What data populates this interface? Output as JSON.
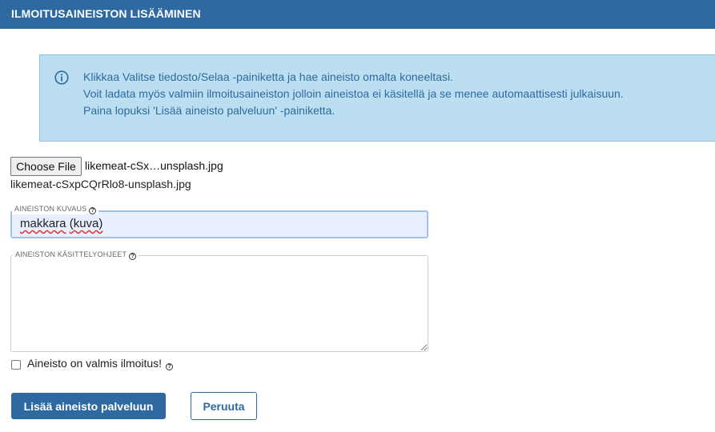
{
  "header": {
    "title": "ILMOITUSAINEISTON LISÄÄMINEN"
  },
  "info": {
    "icon": "info-icon",
    "lines": [
      "Klikkaa Valitse tiedosto/Selaa -painiketta ja hae aineisto omalta koneeltasi.",
      "Voit ladata myös valmiin ilmoitusaineiston jolloin aineistoa ei käsitellä ja se menee automaattisesti julkaisuun.",
      "Paina lopuksi 'Lisää aineisto palveluun' -painiketta."
    ]
  },
  "file": {
    "button_label": "Choose File",
    "chosen_display": "likemeat-cSx…unsplash.jpg",
    "full_name": "likemeat-cSxpCQrRlo8-unsplash.jpg"
  },
  "description": {
    "label": "AINEISTON KUVAUS",
    "value_word1": "makkara",
    "value_word2": "(kuva)"
  },
  "instructions": {
    "label": "AINEISTON KÄSITTELYOHJEET",
    "value": ""
  },
  "ready_checkbox": {
    "label": "Aineisto on valmis ilmoitus!",
    "checked": false
  },
  "help_symbol": "?",
  "buttons": {
    "submit": "Lisää aineisto palveluun",
    "cancel": "Peruuta"
  },
  "colors": {
    "brand": "#2e6aa1",
    "info_bg": "#bcdef1",
    "focus_border": "#9ec1e9"
  }
}
